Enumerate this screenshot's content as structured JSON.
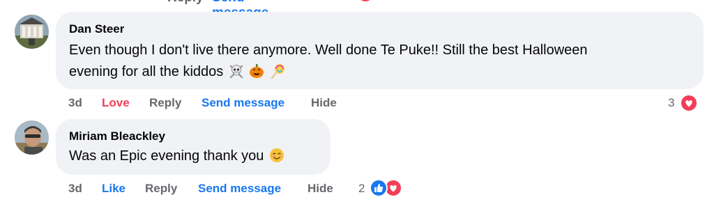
{
  "top_partial": {
    "reply": "Reply",
    "send_message": "Send message"
  },
  "comments": [
    {
      "author": "Dan Steer",
      "text_line1": "Even though I don't live there anymore. Well done Te Puke!! Still the best Halloween",
      "text_line2": "evening for all the kiddos",
      "emojis": [
        "skull-crossbones-icon",
        "jack-o-lantern-icon",
        "lollipop-icon"
      ],
      "actions": {
        "time": "3d",
        "reaction": "Love",
        "reply": "Reply",
        "send_message": "Send message",
        "hide": "Hide"
      },
      "reaction_count": "3",
      "reaction_icons": [
        "heart-reaction-icon"
      ]
    },
    {
      "author": "Miriam Bleackley",
      "text_line1": "Was an Epic evening thank you",
      "emojis": [
        "smiling-face-icon"
      ],
      "actions": {
        "time": "3d",
        "reaction": "Like",
        "reply": "Reply",
        "send_message": "Send message",
        "hide": "Hide"
      },
      "reaction_count": "2",
      "reaction_icons": [
        "like-reaction-icon",
        "heart-reaction-icon"
      ]
    }
  ],
  "colors": {
    "bubble": "#f0f2f5",
    "link_blue": "#1877f2",
    "love_red": "#f33e58",
    "muted": "#65676b"
  }
}
